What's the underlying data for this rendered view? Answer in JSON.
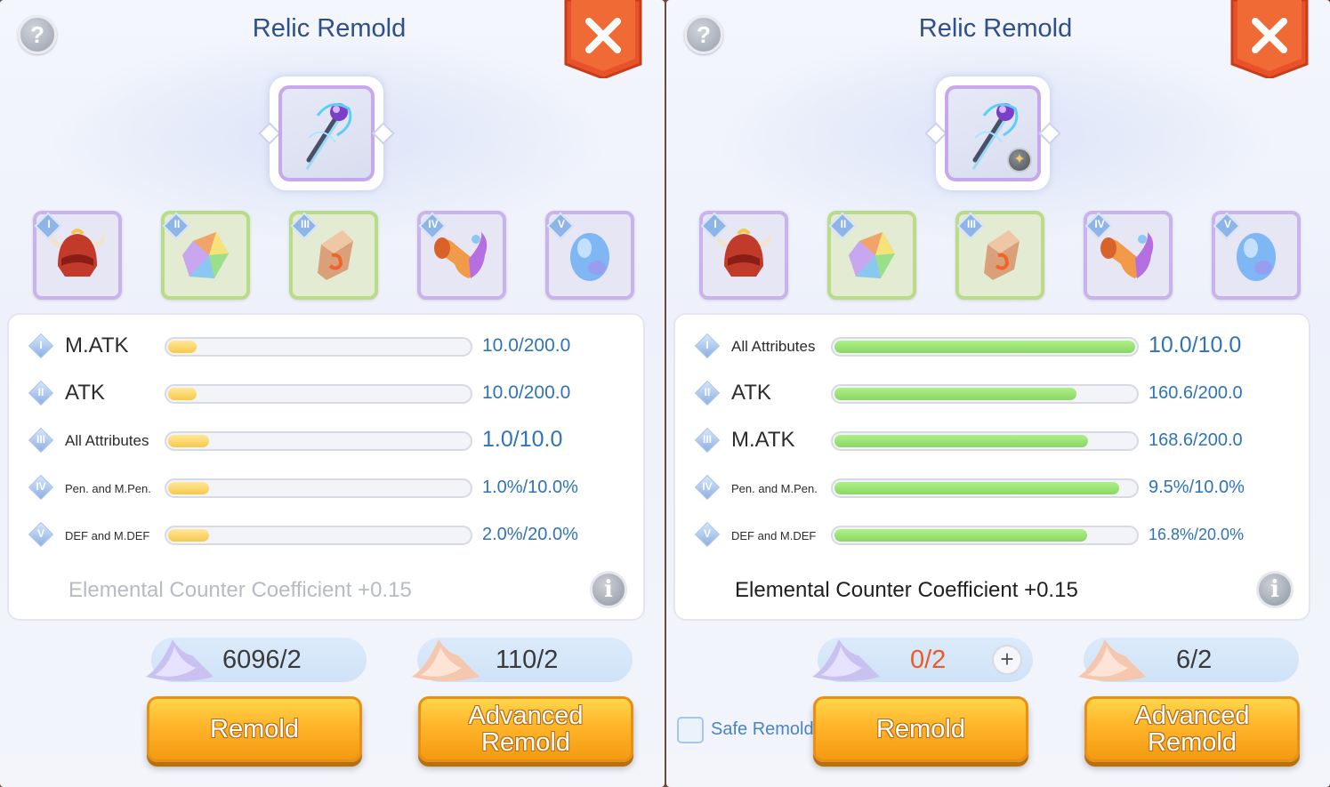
{
  "panels": [
    {
      "title": "Relic Remold",
      "help_label": "?",
      "info_label": "i",
      "slot_labels": [
        "I",
        "II",
        "III",
        "IV",
        "V"
      ],
      "stats": [
        {
          "roman": "I",
          "name": "M.ATK",
          "value": "10.0/200.0",
          "fill_percent": 5
        },
        {
          "roman": "II",
          "name": "ATK",
          "value": "10.0/200.0",
          "fill_percent": 5
        },
        {
          "roman": "III",
          "name": "All Attributes",
          "value": "1.0/10.0",
          "fill_percent": 10
        },
        {
          "roman": "IV",
          "name": "Pen. and M.Pen.",
          "value": "1.0%/10.0%",
          "fill_percent": 10
        },
        {
          "roman": "V",
          "name": "DEF and M.DEF",
          "value": "2.0%/20.0%",
          "fill_percent": 10
        }
      ],
      "coefficient": "Elemental Counter Coefficient +0.15",
      "cost_basic": "6096/2",
      "cost_advanced": "110/2",
      "remold_button": "Remold",
      "advanced_line1": "Advanced",
      "advanced_line2": "Remold"
    },
    {
      "title": "Relic Remold",
      "help_label": "?",
      "info_label": "i",
      "slot_labels": [
        "I",
        "II",
        "III",
        "IV",
        "V"
      ],
      "stats": [
        {
          "roman": "I",
          "name": "All Attributes",
          "value": "10.0/10.0",
          "fill_percent": 100
        },
        {
          "roman": "II",
          "name": "ATK",
          "value": "160.6/200.0",
          "fill_percent": 80.3
        },
        {
          "roman": "III",
          "name": "M.ATK",
          "value": "168.6/200.0",
          "fill_percent": 84.3
        },
        {
          "roman": "IV",
          "name": "Pen. and M.Pen.",
          "value": "9.5%/10.0%",
          "fill_percent": 95
        },
        {
          "roman": "V",
          "name": "DEF and M.DEF",
          "value": "16.8%/20.0%",
          "fill_percent": 84
        }
      ],
      "coefficient": "Elemental Counter Coefficient +0.15",
      "cost_basic": "0/2",
      "cost_plus": "+",
      "cost_advanced": "6/2",
      "safe_remold": "Safe Remold",
      "remold_button": "Remold",
      "advanced_line1": "Advanced",
      "advanced_line2": "Remold"
    }
  ],
  "colors": {
    "title": "#2f4f8a",
    "value": "#2f73b8",
    "bar_yellow": "#f6c94a",
    "bar_green": "#8ad665",
    "close_red": "#e8512a",
    "button_orange": "#ffb52a"
  },
  "icons": {
    "close": "close-x-icon",
    "help": "question-icon",
    "info": "info-icon",
    "relic": "staff-relic-icon",
    "slots": [
      "horned-helmet-icon",
      "rainbow-crystal-icon",
      "amber-stone-icon",
      "horn-trumpet-icon",
      "blue-egg-icon"
    ],
    "cost_basic": "lavender-powder-icon",
    "cost_advanced": "peach-powder-icon"
  }
}
